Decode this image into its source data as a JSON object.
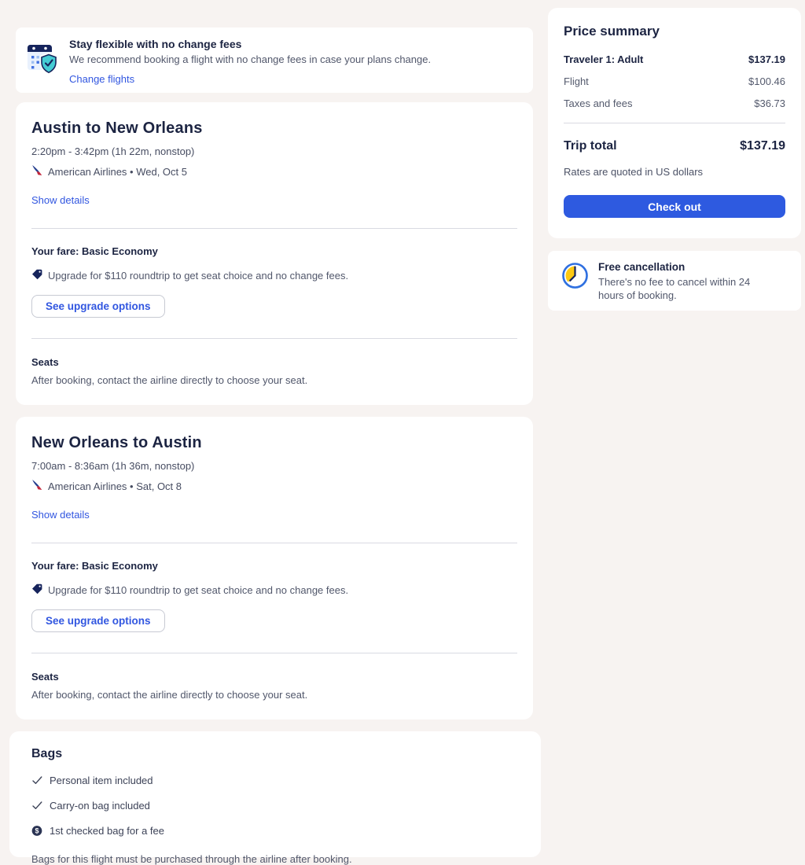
{
  "banner": {
    "title": "Stay flexible with no change fees",
    "body": "We recommend booking a flight with no change fees in case your plans change.",
    "link": "Change flights"
  },
  "flights": [
    {
      "title": "Austin to New Orleans",
      "times": "2:20pm - 3:42pm (1h 22m, nonstop)",
      "airline": "American Airlines • Wed, Oct 5",
      "details_link": "Show details",
      "fare_label": "Your fare: Basic Economy",
      "upgrade_text": "Upgrade for $110 roundtrip to get seat choice and no change fees.",
      "upgrade_button": "See upgrade options",
      "seats_title": "Seats",
      "seats_text": "After booking, contact the airline directly to choose your seat."
    },
    {
      "title": "New Orleans to Austin",
      "times": "7:00am - 8:36am (1h 36m, nonstop)",
      "airline": "American Airlines • Sat, Oct 8",
      "details_link": "Show details",
      "fare_label": "Your fare: Basic Economy",
      "upgrade_text": "Upgrade for $110 roundtrip to get seat choice and no change fees.",
      "upgrade_button": "See upgrade options",
      "seats_title": "Seats",
      "seats_text": "After booking, contact the airline directly to choose your seat."
    }
  ],
  "bags": {
    "title": "Bags",
    "items": [
      {
        "icon": "check-icon",
        "label": "Personal item included"
      },
      {
        "icon": "check-icon",
        "label": "Carry-on bag included"
      },
      {
        "icon": "dollar-icon",
        "glyph": "$",
        "label": "1st checked bag for a fee"
      }
    ],
    "footer": "Bags for this flight must be purchased through the airline after booking."
  },
  "price_summary": {
    "title": "Price summary",
    "rows": [
      {
        "label": "Traveler 1: Adult",
        "value": "$137.19"
      },
      {
        "label": "Flight",
        "value": "$100.46"
      },
      {
        "label": "Taxes and fees",
        "value": "$36.73"
      }
    ],
    "trip_total_label": "Trip total",
    "trip_total_value": "$137.19",
    "rates_note": "Rates are quoted in US dollars",
    "checkout_button": "Check out"
  },
  "free_cancellation": {
    "title": "Free cancellation",
    "body": "There's no fee to cancel within 24 hours of booking."
  },
  "colors": {
    "page_bg": "#f7f3f1",
    "accent_blue": "#3156e0",
    "button_blue": "#2e5ae0",
    "heading_navy": "#1c2442",
    "body_slate": "#51576b",
    "shield_teal": "#45ccd4",
    "clock_yellow": "#fdc913",
    "aa_red": "#c4273c",
    "aa_navy": "#27408f"
  }
}
